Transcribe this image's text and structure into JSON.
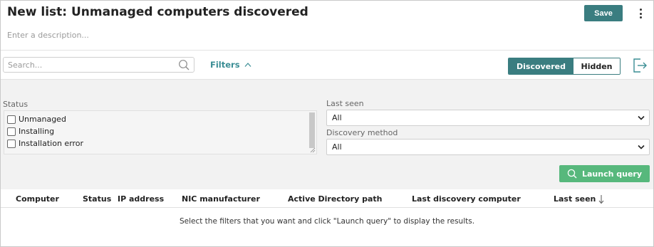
{
  "header": {
    "title": "New list: Unmanaged computers discovered",
    "description_placeholder": "Enter a description...",
    "save_label": "Save"
  },
  "toolbar": {
    "search_placeholder": "Search...",
    "filters_label": "Filters",
    "segments": [
      {
        "label": "Discovered",
        "selected": true
      },
      {
        "label": "Hidden",
        "selected": false
      }
    ],
    "export_icon": "export-icon"
  },
  "filters": {
    "status_label": "Status",
    "status_options": [
      {
        "label": "Unmanaged",
        "checked": false
      },
      {
        "label": "Installing",
        "checked": false
      },
      {
        "label": "Installation error",
        "checked": false
      }
    ],
    "last_seen_label": "Last seen",
    "last_seen_value": "All",
    "discovery_method_label": "Discovery method",
    "discovery_method_value": "All",
    "launch_label": "Launch query"
  },
  "table": {
    "columns": [
      "Computer",
      "Status",
      "IP address",
      "NIC manufacturer",
      "Active Directory path",
      "Last discovery computer",
      "Last seen"
    ],
    "empty_message": "Select the filters that you want and click \"Launch query\" to display the results."
  },
  "colors": {
    "accent": "#3a7d80",
    "link": "#3a8d94",
    "launch": "#57b87c",
    "panel_bg": "#f2f2f2"
  }
}
